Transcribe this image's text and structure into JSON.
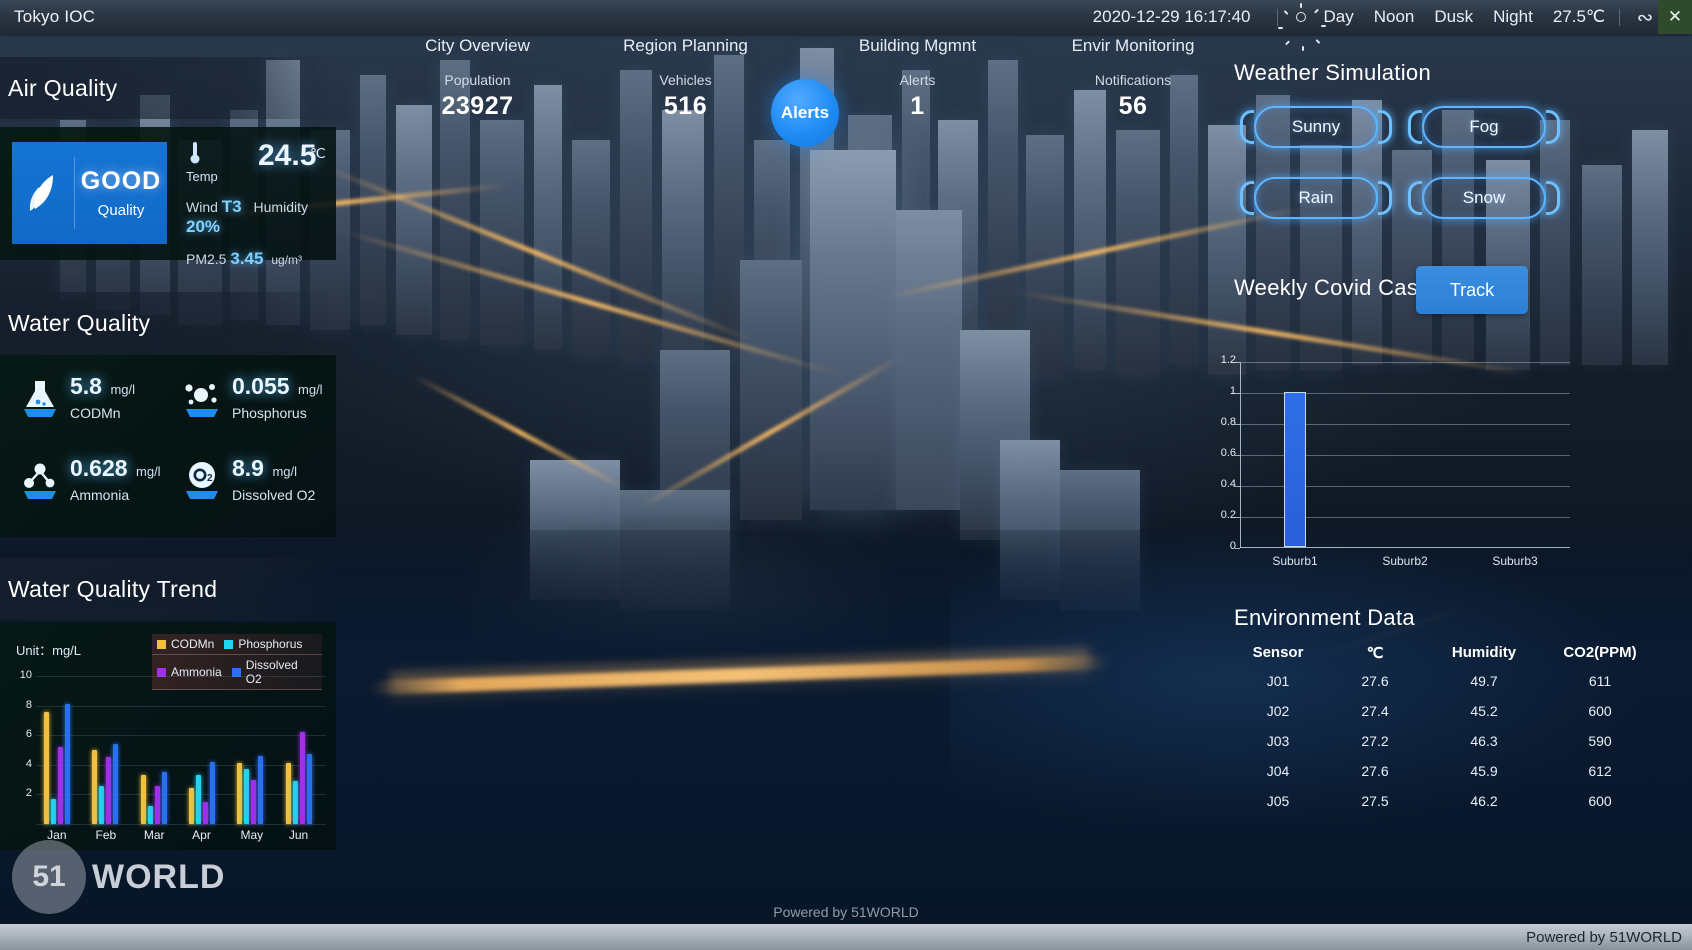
{
  "topbar": {
    "app_title": "Tokyo IOC",
    "datetime": "2020-12-29 16:17:40",
    "sun_icon": "sun-icon",
    "time_modes": [
      "Day",
      "Noon",
      "Dusk",
      "Night"
    ],
    "temperature": "27.5℃",
    "restore_icon": "restore-icon",
    "close_icon": "close-icon"
  },
  "kpis": [
    {
      "section": "City Overview",
      "label": "Population",
      "value": "23927"
    },
    {
      "section": "Region Planning",
      "label": "Vehicles",
      "value": "516"
    },
    {
      "section": "Building Mgmnt",
      "label": "Alerts",
      "value": "1"
    },
    {
      "section": "Envir Monitoring",
      "label": "Notifications",
      "value": "56"
    }
  ],
  "alerts_bubble": {
    "label": "Alerts"
  },
  "air_quality": {
    "heading": "Air Quality",
    "grade": "GOOD",
    "grade_sub": "Quality",
    "leaf_icon": "leaf-icon",
    "thermometer_icon": "thermometer-icon",
    "temp_label": "Temp",
    "temp_value": "24.5",
    "temp_unit": "℃",
    "wind_label": "Wind",
    "wind_value": "T3",
    "humidity_label": "Humidity",
    "humidity_value": "20%",
    "pm_label": "PM2.5",
    "pm_value": "3.45",
    "pm_unit": "ug/m³"
  },
  "water_quality": {
    "heading": "Water Quality",
    "metrics": [
      {
        "icon": "flask-icon",
        "value": "5.8",
        "unit": "mg/l",
        "name": "CODMn"
      },
      {
        "icon": "molecule-icon",
        "value": "0.055",
        "unit": "mg/l",
        "name": "Phosphorus"
      },
      {
        "icon": "ammonia-icon",
        "value": "0.628",
        "unit": "mg/l",
        "name": "Ammonia"
      },
      {
        "icon": "o2-icon",
        "value": "8.9",
        "unit": "mg/l",
        "name": "Dissolved O2"
      }
    ]
  },
  "water_trend": {
    "heading": "Water Quality Trend",
    "unit_label": "Unit：mg/L"
  },
  "weather_simulation": {
    "heading": "Weather Simulation",
    "buttons": [
      "Sunny",
      "Fog",
      "Rain",
      "Snow"
    ]
  },
  "covid": {
    "heading": "Weekly Covid Case",
    "track_label": "Track"
  },
  "environment_data": {
    "heading": "Environment Data",
    "columns": [
      "Sensor",
      "℃",
      "Humidity",
      "CO2(PPM)"
    ],
    "rows": [
      [
        "J01",
        "27.6",
        "49.7",
        "611"
      ],
      [
        "J02",
        "27.4",
        "45.2",
        "600"
      ],
      [
        "J03",
        "27.2",
        "46.3",
        "590"
      ],
      [
        "J04",
        "27.6",
        "45.9",
        "612"
      ],
      [
        "J05",
        "27.5",
        "46.2",
        "600"
      ]
    ]
  },
  "watermark": {
    "circle_text": "51",
    "word": "WORLD",
    "powered_center": "Powered by 51WORLD",
    "powered_bottom": "Powered by 51WORLD"
  },
  "chart_data": [
    {
      "id": "water_quality_trend",
      "type": "bar",
      "title": "Water Quality Trend",
      "xlabel": "",
      "ylabel": "Unit：mg/L",
      "ylim": [
        0,
        10
      ],
      "yticks": [
        0,
        2,
        4,
        6,
        8,
        10
      ],
      "grid": true,
      "legend_position": "top-right",
      "categories": [
        "Jan",
        "Feb",
        "Mar",
        "Apr",
        "May",
        "Jun"
      ],
      "series": [
        {
          "name": "CODMn",
          "color": "#f0c040",
          "values": [
            7.6,
            5.0,
            3.3,
            2.4,
            4.1,
            4.1
          ]
        },
        {
          "name": "Phosphorus",
          "color": "#22d3ee",
          "values": [
            1.7,
            2.6,
            1.2,
            3.3,
            3.7,
            2.9
          ]
        },
        {
          "name": "Ammonia",
          "color": "#a22ee8",
          "values": [
            5.2,
            4.5,
            2.6,
            1.5,
            3.0,
            6.2
          ]
        },
        {
          "name": "Dissolved O2",
          "color": "#2a6ff0",
          "values": [
            8.1,
            5.4,
            3.5,
            4.2,
            4.6,
            4.7
          ]
        }
      ]
    },
    {
      "id": "weekly_covid_case",
      "type": "bar",
      "title": "Weekly Covid Case",
      "xlabel": "",
      "ylabel": "",
      "ylim": [
        0,
        1.2
      ],
      "yticks": [
        0,
        0.2,
        0.4,
        0.6,
        0.8,
        1,
        1.2
      ],
      "ytick_labels": [
        "0",
        "0.2",
        "0.4",
        "0.6",
        "0.8",
        "1",
        "1.2"
      ],
      "grid": true,
      "categories": [
        "Suburb1",
        "Suburb2",
        "Suburb3"
      ],
      "values": [
        1,
        0,
        0
      ],
      "bar_color": "#2f6fe6"
    }
  ]
}
